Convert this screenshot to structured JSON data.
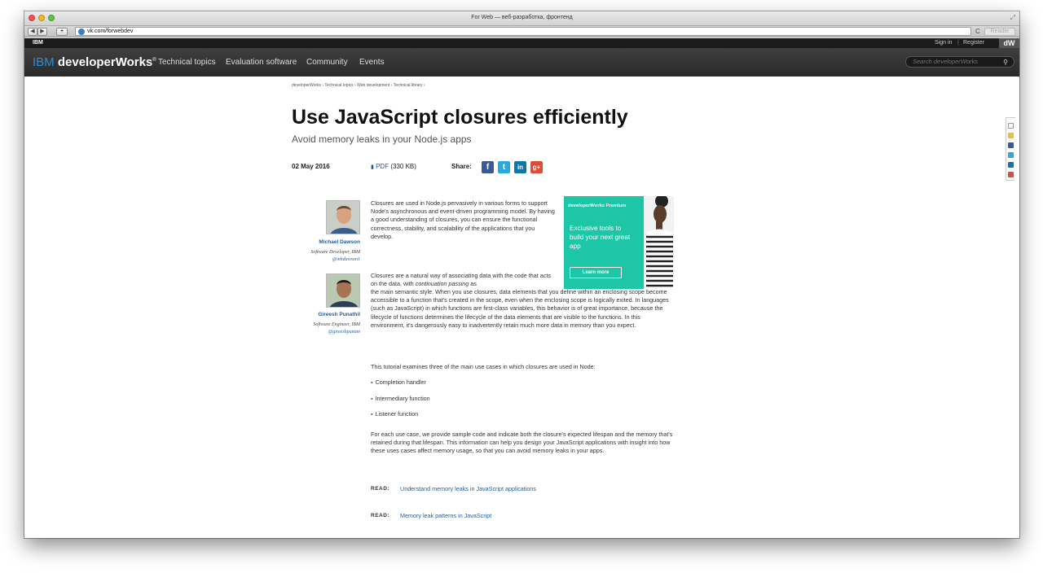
{
  "browser": {
    "window_title": "For Web — веб-разработка, фронтенд",
    "url": "vk.com/forwebdev",
    "reader_label": "Reader",
    "nav_back": "◀",
    "nav_forward": "▶",
    "new_tab": "+",
    "reload": "C"
  },
  "ibm_bar": {
    "label": "IBM",
    "sign_in": "Sign in",
    "separator": "|",
    "register": "Register",
    "badge": "dW"
  },
  "nav": {
    "logo_ibm": "IBM",
    "logo_dw": "developerWorks",
    "logo_reg": "®",
    "items": [
      "Technical topics",
      "Evaluation software",
      "Community",
      "Events"
    ],
    "search_placeholder": "Search developerWorks"
  },
  "breadcrumb": "developerWorks  ›  Technical topics  ›  Web development  ›  Technical library  ›",
  "article": {
    "title": "Use JavaScript closures efficiently",
    "subtitle": "Avoid memory leaks in your Node.js apps",
    "date": "02 May 2016",
    "pdf_label": "PDF",
    "pdf_size": "(330 KB)",
    "share_label": "Share:",
    "social": [
      "f",
      "t",
      "in",
      "g+"
    ],
    "authors": [
      {
        "name": "Michael Dawson",
        "role": "Software Developer, IBM",
        "twitter": "@mhdawson1"
      },
      {
        "name": "Gireesh Punathil",
        "role": "Software Engineer, IBM",
        "twitter": "@gireeshpunam"
      }
    ],
    "para1": "Closures are used in Node.js pervasively in various forms to support Node's asynchronous and event-driven programming model. By having a good understanding of closures, you can ensure the functional correctness, stability, and scalability of the applications that you develop.",
    "para2_a": "Closures are a natural way of associating data with the code that acts on the data, with ",
    "para2_em": "continuation passing",
    "para2_b": " as",
    "para2_rest": "the main semantic style. When you use closures, data elements that you define within an enclosing scope become accessible to a function that's created in the scope, even when the enclosing scope is logically exited. In languages (such as JavaScript) in which functions are first-class variables, this behavior is of great importance, because the lifecycle of functions determines the lifecycle of the data elements that are visible to the functions. In this environment, it's dangerously easy to inadvertently retain much more data in memory than you expect.",
    "para3": "This tutorial examines three of the main use cases in which closures are used in Node:",
    "list": [
      "Completion handler",
      "Intermediary function",
      "Listener function"
    ],
    "para4": "For each use case, we provide sample code and indicate both the closure's expected lifespan and the memory that's retained during that lifespan. This information can help you design your JavaScript applications with insight into how these uses cases affect memory usage, so that you can avoid memory leaks in your apps.",
    "read_label": "READ:",
    "read1": "Understand memory leaks in JavaScript applications",
    "read2": "Memory leak patterns in JavaScript"
  },
  "promo": {
    "heading": "developerWorks Premium",
    "body": "Exclusive tools to build your next great app",
    "button": "Learn more"
  },
  "colors": {
    "accent_blue": "#1f5fa5",
    "promo_teal": "#1ec6a8",
    "nav_dark": "#2f2f2f"
  }
}
